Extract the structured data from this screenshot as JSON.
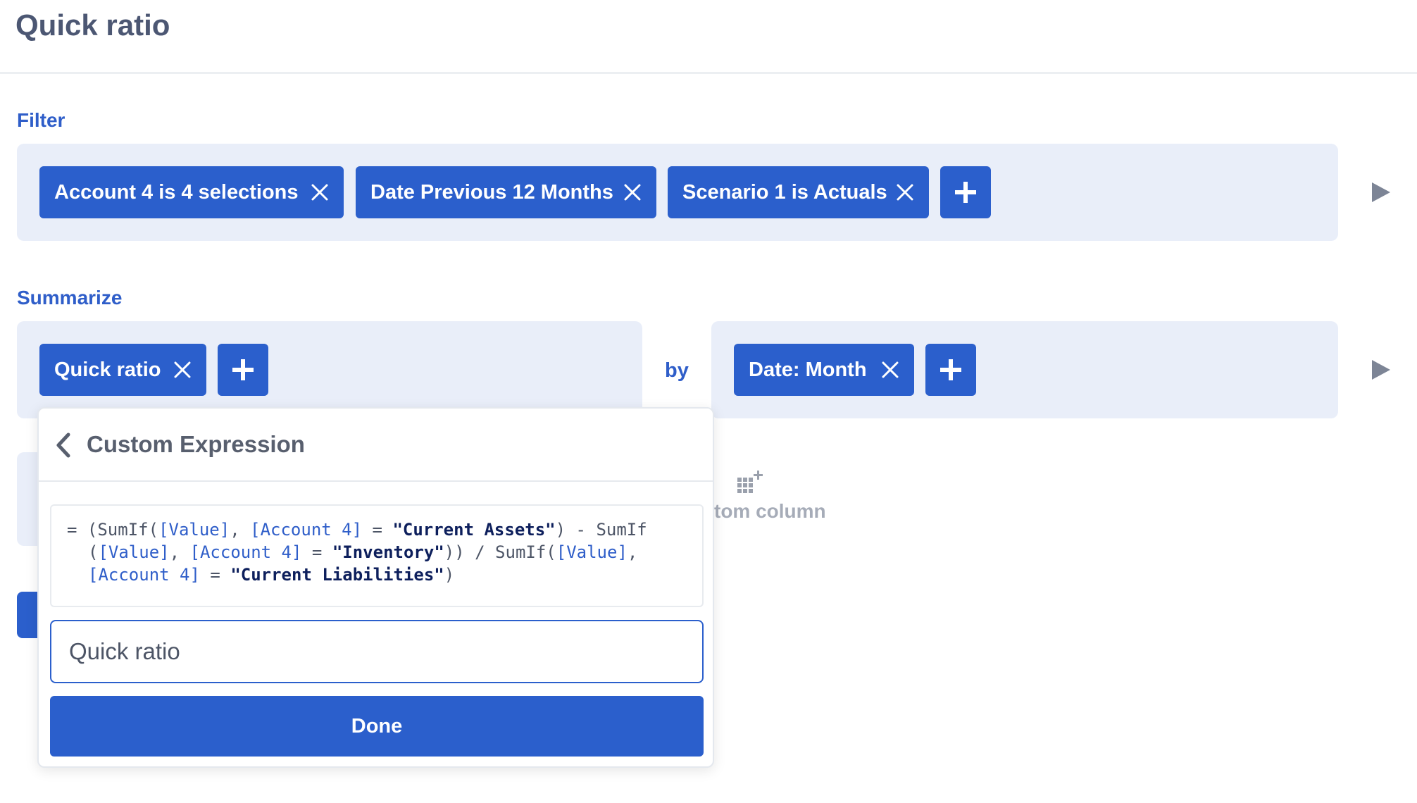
{
  "header": {
    "title": "Quick ratio"
  },
  "filter": {
    "label": "Filter",
    "pills": [
      {
        "label": "Account 4 is 4 selections"
      },
      {
        "label": "Date Previous 12 Months"
      },
      {
        "label": "Scenario 1 is Actuals"
      }
    ]
  },
  "summarize": {
    "label": "Summarize",
    "metric_pill": "Quick ratio",
    "by_label": "by",
    "group_pill": "Date: Month"
  },
  "background": {
    "custom_column_label": "tom column"
  },
  "custom_expression": {
    "title": "Custom Expression",
    "expression": "= (SumIf([Value], [Account 4] = \"Current Assets\") - SumIf([Value], [Account 4] = \"Inventory\")) / SumIf([Value], [Account 4] = \"Current Liabilities\")",
    "tokens": {
      "eq": "=",
      "open": "(",
      "sumif": "SumIf(",
      "value_field": "[Value]",
      "comma": ",",
      "account_field": "[Account 4]",
      "eq_op": "=",
      "current_assets": "\"Current Assets\"",
      "minus": "-",
      "sumif_break": "SumIf",
      "inventory": "\"Inventory\"",
      "divide": "/",
      "current_liabilities": "\"Current Liabilities\""
    },
    "name_value": "Quick ratio",
    "done_label": "Done"
  },
  "icons": [
    "close-icon",
    "plus-icon",
    "play-icon",
    "chevron-left-icon",
    "add-column-icon"
  ],
  "colors": {
    "accent": "#2b5fcc",
    "panel": "#e9eef9",
    "label": "#2f5ec9",
    "text": "#4c5773"
  }
}
